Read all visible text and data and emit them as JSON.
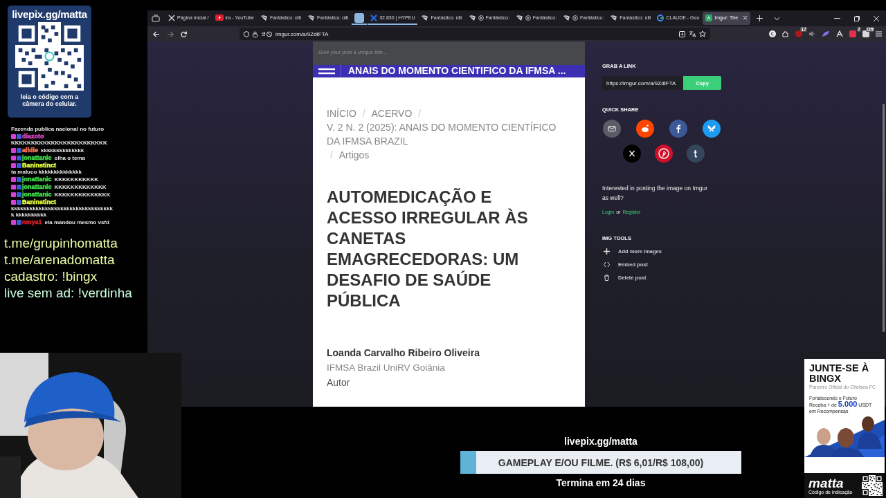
{
  "stream_overlay": {
    "qr_card": {
      "title": "livepix.gg/matta",
      "caption": "leia o código com a câmera do celular."
    },
    "chat": [
      {
        "kind": "continuation",
        "text": "Fazenda publica nacional no futuro"
      },
      {
        "kind": "message",
        "user": "diazoto",
        "color": "#e04cc8",
        "text": "KKKKKKKKKKKKKKKKKKKKKKKK"
      },
      {
        "kind": "message",
        "user": "alldie",
        "color": "#ff7a5a",
        "text": "kkkkkkkkkkkkkk"
      },
      {
        "kind": "message",
        "user": "jonattanic",
        "color": "#3ee04a",
        "text": "olha o tema"
      },
      {
        "kind": "message",
        "user": "Baninstinct",
        "color": "#e6ff3c",
        "text": "ta maluco kkkkkkkkkkkkkk"
      },
      {
        "kind": "message",
        "user": "jonattanic",
        "color": "#3ee04a",
        "text": "KKKKKKKKKKK"
      },
      {
        "kind": "message",
        "user": "jonattanic",
        "color": "#3ee04a",
        "text": "KKKKKKKKKKKKK"
      },
      {
        "kind": "message",
        "user": "jonattanic",
        "color": "#3ee04a",
        "text": "KKKKKKKKKKKKKK"
      },
      {
        "kind": "message",
        "user": "Baninstinct",
        "color": "#e6ff3c",
        "text": "kkkkkkkkkkkkkkkkkkkkkkkkkkkkkkkkkk kkkkkkkkkk"
      },
      {
        "kind": "message",
        "user": "nmya1",
        "color": "#d8202a",
        "text": "ela mandou mesmo vsfd"
      }
    ],
    "links": [
      "t.me/grupinhomatta",
      "t.me/arenadomatta",
      "cadastro: !bingx",
      "live sem ad: !verdinha"
    ],
    "goal": {
      "site": "livepix.gg/matta",
      "label": "GAMEPLAY E/OU FILME. (R$ 6,01/R$ 108,00)",
      "level": 0.056,
      "ends": "Termina em 24 dias"
    },
    "ad": {
      "headline": "JUNTE-SE À BINGX",
      "subtitle": "Parceiro Oficial do Chelsea FC",
      "promo": "Fortalecendo o Futuro Receba + de **5.000** USDT em Recompensas",
      "brand": "matta",
      "brand_caption": "Código de indicação"
    }
  },
  "browser": {
    "tabs": [
      {
        "kind": "x",
        "title": "Página Inicial /",
        "selected": false,
        "grouped": false,
        "playing": false
      },
      {
        "kind": "video",
        "title": "ira - YouTube",
        "selected": false,
        "grouped": false,
        "playing": false
      },
      {
        "kind": "news",
        "title": "Fantástico: últi",
        "selected": false,
        "grouped": false,
        "playing": false
      },
      {
        "kind": "news",
        "title": "Fantástico: últi",
        "selected": false,
        "grouped": false,
        "playing": false
      },
      {
        "kind": "pinned",
        "selected": false,
        "grouped": true,
        "playing": false
      },
      {
        "kind": "crypto",
        "title": "32.830 | HYPEU",
        "selected": false,
        "grouped": true,
        "playing": false
      },
      {
        "kind": "news",
        "title": "Fantástico: últi",
        "selected": false,
        "grouped": false,
        "playing": false
      },
      {
        "kind": "news",
        "title": "Fantástico:",
        "selected": false,
        "grouped": false,
        "playing": true
      },
      {
        "kind": "news",
        "title": "Fantástico:",
        "selected": false,
        "grouped": false,
        "playing": true
      },
      {
        "kind": "news",
        "title": "Fantástico:",
        "selected": false,
        "grouped": false,
        "playing": true
      },
      {
        "kind": "news",
        "title": "Fantástico: últi",
        "selected": false,
        "grouped": false,
        "playing": false
      },
      {
        "kind": "search",
        "title": "CLAUDE - Goo",
        "selected": false,
        "grouped": false,
        "playing": false
      },
      {
        "kind": "imgur",
        "title": "Imgur: The",
        "selected": true,
        "grouped": false,
        "playing": false
      }
    ],
    "address": "imgur.com/a/9ZdtFTA",
    "extension_badges": [
      "17",
      "7",
      "Off"
    ],
    "post_title": {
      "placeholder": "Give your post a unique title..."
    },
    "image": {
      "header": "ANAIS DO MOMENTO CIENTIFICO DA IFMSA ...",
      "separator": "/",
      "breadcrumb": [
        "INÍCIO",
        "ACERVO",
        "V. 2 N. 2 (2025): ANAIS DO MOMENTO CIENTÍFICO DA IFMSA BRAZIL",
        "Artigos"
      ],
      "title": "AUTOMEDICAÇÃO E ACESSO IRREGULAR ÀS CANETAS EMAGRECEDORAS: UM DESAFIO DE SAÚDE PÚBLICA",
      "author": "Loanda Carvalho Ribeiro Oliveira",
      "affiliation": "IFMSA Brazil UniRV Goiânia",
      "role": "Autor"
    },
    "sidebar": {
      "grab_link": {
        "heading": "GRAB A LINK",
        "url": "https://imgur.com/a/9ZdtFTA",
        "button": "Copy"
      },
      "quick_share": {
        "heading": "QUICK SHARE"
      },
      "prompt": "Interested in posting the image on Imgur as well?",
      "login": "Login",
      "or": "or",
      "register": "Register",
      "tools": {
        "heading": "IMG TOOLS",
        "items": [
          "Add more images",
          "Embed post",
          "Delete post"
        ]
      }
    }
  }
}
